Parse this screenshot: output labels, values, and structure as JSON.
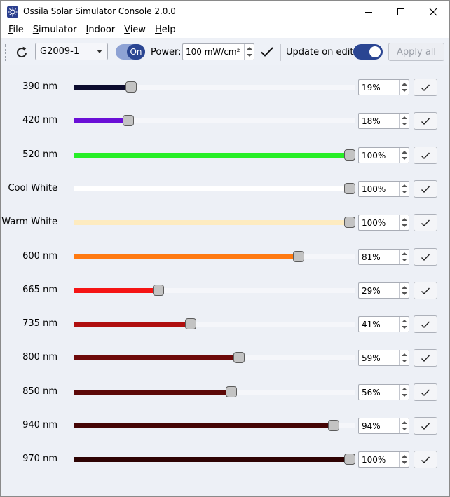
{
  "window": {
    "title": "Ossila Solar Simulator Console 2.0.0",
    "min_icon": "minimize-icon",
    "max_icon": "maximize-icon",
    "close_icon": "close-icon"
  },
  "menu": [
    {
      "accel": "F",
      "rest": "ile"
    },
    {
      "accel": "S",
      "rest": "imulator"
    },
    {
      "accel": "I",
      "rest": "ndoor"
    },
    {
      "accel": "V",
      "rest": "iew"
    },
    {
      "accel": "H",
      "rest": "elp"
    }
  ],
  "toolbar": {
    "device": "G2009-1",
    "on_label": "On",
    "power_label": "Power:",
    "power_value": "100 mW/cm²",
    "update_label": "Update on edit:",
    "update_on": true,
    "apply_label": "Apply all"
  },
  "colors": {
    "accent": "#2a4592"
  },
  "channels": [
    {
      "label": "390 nm",
      "value": "19%",
      "level": 0.19,
      "color": "#0c0c2e"
    },
    {
      "label": "420 nm",
      "value": "18%",
      "level": 0.18,
      "color": "#6a0fd6"
    },
    {
      "label": "520 nm",
      "value": "100%",
      "level": 1.0,
      "color": "#27ee27"
    },
    {
      "label": "Cool White",
      "value": "100%",
      "level": 1.0,
      "color": "#ffffff"
    },
    {
      "label": "Warm White",
      "value": "100%",
      "level": 1.0,
      "color": "#fdebc0"
    },
    {
      "label": "600 nm",
      "value": "81%",
      "level": 0.81,
      "color": "#ff7a12"
    },
    {
      "label": "665 nm",
      "value": "29%",
      "level": 0.29,
      "color": "#f51414"
    },
    {
      "label": "735 nm",
      "value": "41%",
      "level": 0.41,
      "color": "#b00f0f"
    },
    {
      "label": "800 nm",
      "value": "59%",
      "level": 0.59,
      "color": "#6e0a0a"
    },
    {
      "label": "850 nm",
      "value": "56%",
      "level": 0.56,
      "color": "#5c0808"
    },
    {
      "label": "940 nm",
      "value": "94%",
      "level": 0.94,
      "color": "#450505"
    },
    {
      "label": "970 nm",
      "value": "100%",
      "level": 1.0,
      "color": "#2e0303"
    }
  ]
}
